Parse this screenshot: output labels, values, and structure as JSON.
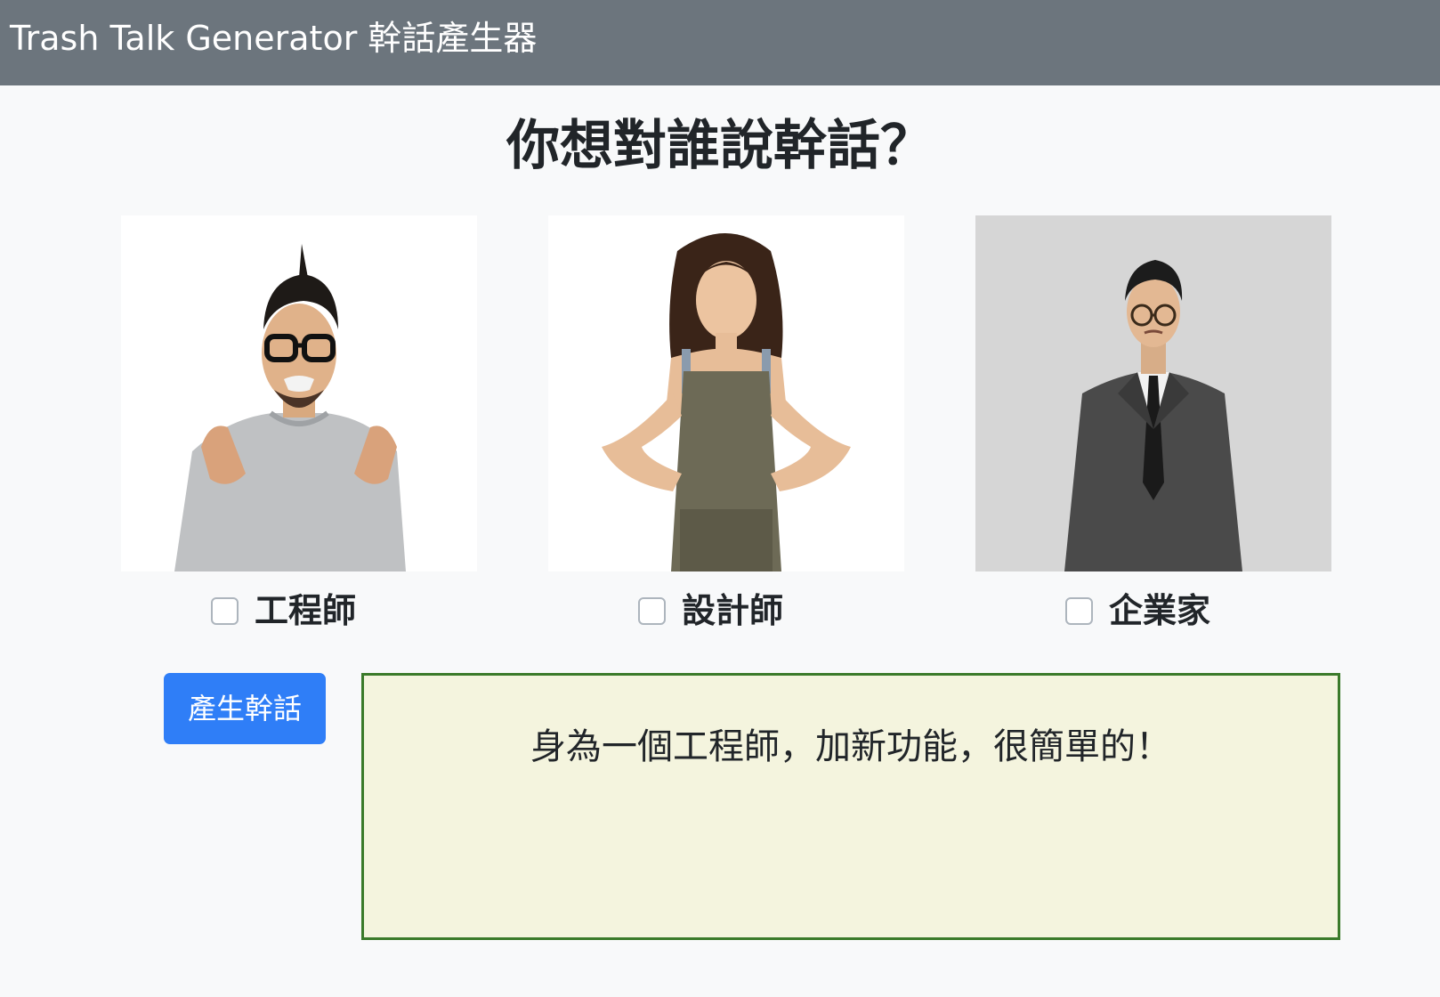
{
  "navbar": {
    "brand": "Trash Talk Generator 幹話產生器"
  },
  "heading": "你想對誰說幹話？",
  "targets": [
    {
      "label": "工程師",
      "checked": false,
      "photo": "angry-engineer-photo"
    },
    {
      "label": "設計師",
      "checked": false,
      "photo": "annoyed-designer-photo"
    },
    {
      "label": "企業家",
      "checked": false,
      "photo": "skeptical-entrepreneur-photo"
    }
  ],
  "generate_button": "產生幹話",
  "result": {
    "text": "身為一個工程師，加新功能，很簡單的！"
  },
  "colors": {
    "navbar": "#6c757d",
    "page_bg": "#f8f9fa",
    "button": "#2f7ef7",
    "result_bg": "#f4f4de",
    "result_border": "#3a7a2a"
  }
}
